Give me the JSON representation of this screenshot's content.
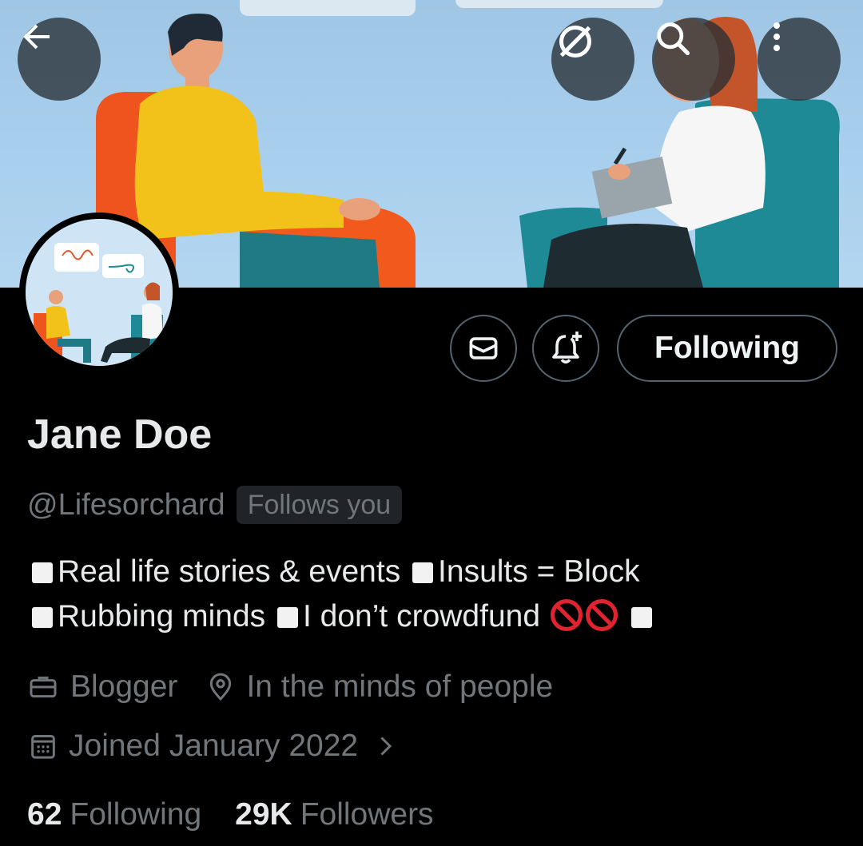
{
  "profile": {
    "name": "Jane Doe",
    "handle": "@Lifesorchard",
    "follows_you": "Follows you",
    "bio_line1_a": "Real life stories & events",
    "bio_line1_b": "Insults = Block",
    "bio_line2_a": "Rubbing minds",
    "bio_line2_b": "I don’t crowdfund",
    "profession": "Blogger",
    "location": "In the minds of people",
    "joined": "Joined January 2022",
    "following_count": "62",
    "following_label": "Following",
    "followers_count": "29K",
    "followers_label": "Followers"
  },
  "actions": {
    "follow_state": "Following"
  },
  "icons": {
    "back": "arrow-left-icon",
    "grok": "slash-circle-icon",
    "search": "search-icon",
    "more": "more-vertical-icon",
    "message": "envelope-icon",
    "notify": "bell-plus-icon",
    "profession": "briefcase-icon",
    "location": "location-pin-icon",
    "joined": "calendar-icon",
    "joined_more": "chevron-right-icon"
  },
  "colors": {
    "background": "#000000",
    "primary_text": "#e7e9ea",
    "secondary_text": "#71767b",
    "border": "#536471"
  }
}
